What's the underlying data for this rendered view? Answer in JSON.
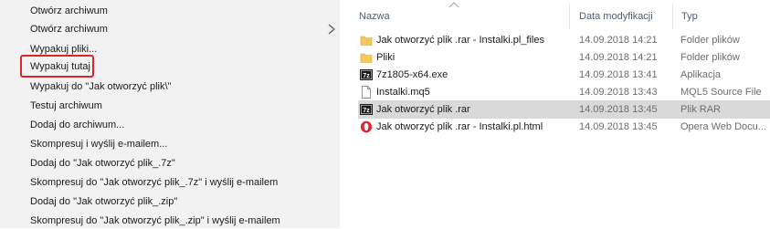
{
  "context_menu": {
    "items": [
      {
        "label": "Otwórz archiwum"
      },
      {
        "label": "Otwórz archiwum"
      },
      {
        "label": "Wypakuj pliki..."
      },
      {
        "label": "Wypakuj tutaj"
      },
      {
        "label": "Wypakuj do \"Jak otworzyć plik\\\""
      },
      {
        "label": "Testuj archiwum"
      },
      {
        "label": "Dodaj do archiwum..."
      },
      {
        "label": "Skompresuj i wyślij e-mailem..."
      },
      {
        "label": "Dodaj do \"Jak otworzyć plik_.7z\""
      },
      {
        "label": "Skompresuj do \"Jak otworzyć plik_.7z\" i wyślij e-mailem"
      },
      {
        "label": "Dodaj do \"Jak otworzyć plik_.zip\""
      },
      {
        "label": "Skompresuj do \"Jak otworzyć plik_.zip\" i wyślij e-mailem"
      }
    ],
    "highlight_color": "#d9262b",
    "submenu_icon": "chevron-right-icon"
  },
  "file_list": {
    "columns": {
      "name": "Nazwa",
      "date": "Data modyfikacji",
      "type": "Typ"
    },
    "files": [
      {
        "name": "Jak otworzyć plik .rar - Instalki.pl_files",
        "date": "14.09.2018 14:21",
        "type": "Folder plików",
        "icon": "folder-icon",
        "selected": false
      },
      {
        "name": "Pliki",
        "date": "14.09.2018 14:21",
        "type": "Folder plików",
        "icon": "folder-icon",
        "selected": false
      },
      {
        "name": "7z1805-x64.exe",
        "date": "14.09.2018 13:41",
        "type": "Aplikacja",
        "icon": "7zip-exe-icon",
        "selected": false
      },
      {
        "name": "Instalki.mq5",
        "date": "14.09.2018 13:43",
        "type": "MQL5 Source File",
        "icon": "document-icon",
        "selected": false
      },
      {
        "name": "Jak otworzyć plik .rar",
        "date": "14.09.2018 13:45",
        "type": "Plik RAR",
        "icon": "7zip-archive-icon",
        "selected": true
      },
      {
        "name": "Jak otworzyć plik .rar - Instalki.pl.html",
        "date": "14.09.2018 13:45",
        "type": "Opera Web Docu...",
        "icon": "opera-icon",
        "selected": false
      }
    ],
    "selected_row_color": "#d9d9d9",
    "folder_color": "#f5c85b"
  }
}
